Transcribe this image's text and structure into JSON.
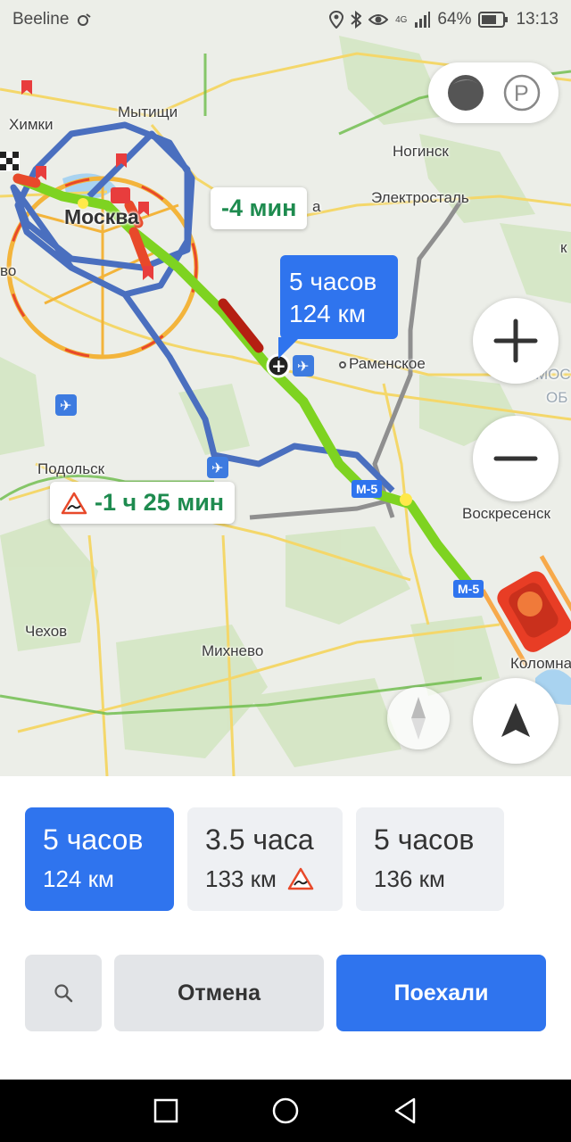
{
  "status": {
    "carrier": "Beeline",
    "battery": "64%",
    "time": "13:13",
    "network": "4G"
  },
  "map": {
    "cities": {
      "khimki": "Химки",
      "mytishchi": "Мытищи",
      "moscow": "Москва",
      "noginsk": "Ногинск",
      "elektrostal": "Электросталь",
      "ramenskoe": "Раменское",
      "podolsk": "Подольск",
      "voskresensk": "Воскресенск",
      "chekhov": "Чехов",
      "mikhnevo": "Михнево",
      "kolomna": "Коломна",
      "edge_left": "во",
      "edge_right_1": "МОС",
      "edge_right_2": "ОБ",
      "edge_right_3": "к",
      "edge_a": "а"
    },
    "bubbles": {
      "alt_fast": "-4 мин",
      "alt_slow": "-1 ч 25 мин",
      "main_time": "5 часов",
      "main_dist": "124 км"
    },
    "road_tags": [
      "М-5",
      "М-5"
    ],
    "colors": {
      "primary_route": "#7ed321",
      "jam": "#e8492a",
      "alt_route": "#4a6fbf",
      "accent": "#2f74ee"
    }
  },
  "map_controls": {
    "layers_icon": "traffic-circle-icon",
    "parking_label": "P",
    "zoom_in": "+",
    "zoom_out": "−"
  },
  "routes": [
    {
      "time": "5 часов",
      "distance": "124 км",
      "active": true,
      "warning": false
    },
    {
      "time": "3.5 часа",
      "distance": "133 км",
      "active": false,
      "warning": true
    },
    {
      "time": "5 часов",
      "distance": "136 км",
      "active": false,
      "warning": false
    }
  ],
  "actions": {
    "cancel": "Отмена",
    "go": "Поехали"
  }
}
